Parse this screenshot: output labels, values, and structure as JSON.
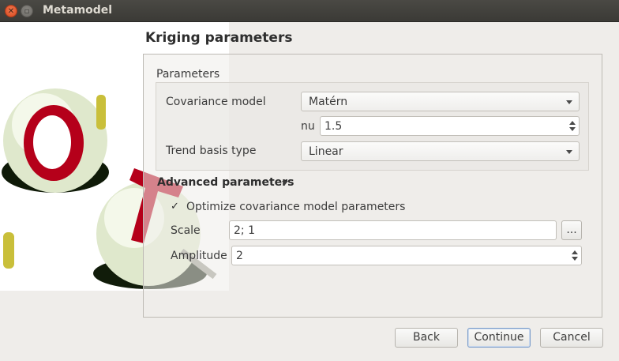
{
  "window": {
    "title": "Metamodel"
  },
  "page": {
    "heading": "Kriging parameters"
  },
  "parameters": {
    "group_title": "Parameters",
    "covariance_model_label": "Covariance model",
    "covariance_model_value": "Matérn",
    "nu_label": "nu",
    "nu_value": "1.5",
    "trend_basis_label": "Trend basis type",
    "trend_basis_value": "Linear"
  },
  "advanced": {
    "title": "Advanced parameters",
    "optimize_checked": true,
    "optimize_label": "Optimize covariance model parameters",
    "optimize_mark": "✓",
    "scale_label": "Scale",
    "scale_value": "2; 1",
    "scale_button_label": "...",
    "amplitude_label": "Amplitude",
    "amplitude_value": "2"
  },
  "buttons": {
    "back": "Back",
    "continue": "Continue",
    "cancel": "Cancel"
  },
  "icons": {
    "close": "close-icon",
    "maximize": "maximize-icon",
    "logo": "openturns-logo"
  },
  "colors": {
    "accent": "#7a9cc9",
    "close_button": "#e05a2b"
  }
}
